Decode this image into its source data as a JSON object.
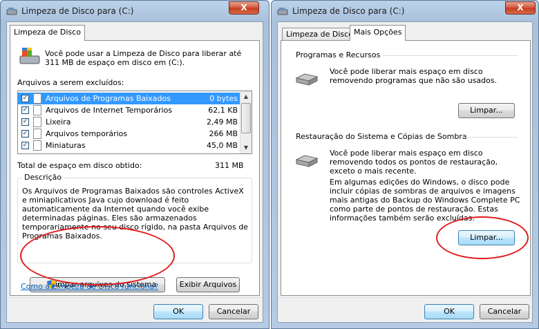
{
  "left_window": {
    "title": "Limpeza de Disco para  (C:)",
    "tab": "Limpeza de Disco",
    "intro": "Você pode usar a Limpeza de Disco para liberar até 311 MB de espaço em disco em  (C:).",
    "files_label": "Arquivos a serem excluídos:",
    "files": [
      {
        "name": "Arquivos de Programas Baixados",
        "size": "0 bytes",
        "checked": true,
        "selected": true
      },
      {
        "name": "Arquivos de Internet Temporários",
        "size": "62,1 KB",
        "checked": true,
        "selected": false
      },
      {
        "name": "Lixeira",
        "size": "2,49 MB",
        "checked": true,
        "selected": false
      },
      {
        "name": "Arquivos temporários",
        "size": "266 MB",
        "checked": true,
        "selected": false
      },
      {
        "name": "Miniaturas",
        "size": "45,0 MB",
        "checked": true,
        "selected": false
      }
    ],
    "total_label": "Total de espaço em disco obtido:",
    "total_value": "311 MB",
    "description_title": "Descrição",
    "description": "Os Arquivos de Programas Baixados são controles ActiveX e miniaplicativos Java cujo download é feito automaticamente da Internet quando você exibe determinadas páginas. Eles são armazenados temporariamente no seu disco rígido, na pasta Arquivos de Programas Baixados.",
    "clean_system_button": "Limpar arquivos do sistema",
    "view_files_button": "Exibir Arquivos",
    "help_link": "Como a Limpeza de Disco funciona?",
    "ok": "OK",
    "cancel": "Cancelar",
    "close": "X"
  },
  "right_window": {
    "title": "Limpeza de Disco para  (C:)",
    "tabs": [
      "Limpeza de Disco",
      "Mais Opções"
    ],
    "programs_title": "Programas e Recursos",
    "programs_text": "Você pode liberar mais espaço em disco removendo programas que não são usados.",
    "programs_button": "Limpar...",
    "restore_title": "Restauração do Sistema e Cópias de Sombra",
    "restore_text": "Você pode liberar mais espaço em disco removendo todos os pontos de restauração, exceto o mais recente.",
    "restore_note": "Em algumas edições do Windows, o disco pode incluir cópias de sombras de arquivos e imagens mais antigas do Backup do Windows Complete PC como parte de pontos de restauração. Estas informações também serão excluídas.",
    "restore_button": "Limpar...",
    "ok": "OK",
    "cancel": "Cancelar",
    "close": "X"
  },
  "colors": {
    "selection": "#3399ff",
    "annotation": "#e21818",
    "link": "#0066cc"
  }
}
